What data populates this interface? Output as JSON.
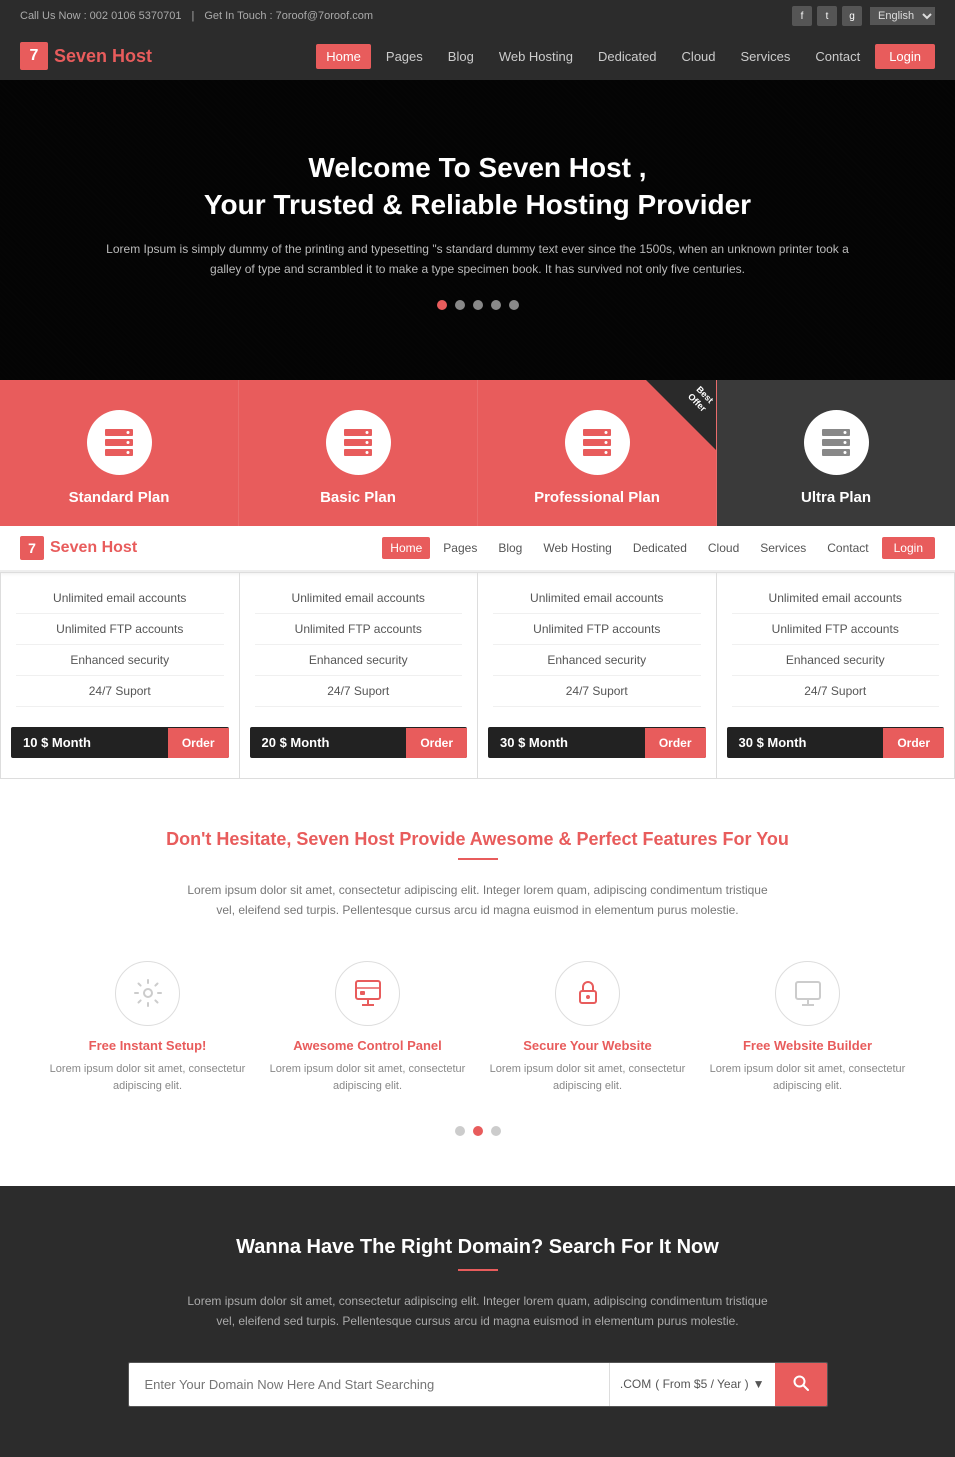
{
  "brand": {
    "number": "7",
    "name": "Seven Host"
  },
  "topbar": {
    "phone_label": "Call Us Now : 002 0106 5370701",
    "separator": "|",
    "email_label": "Get In Touch : 7oroof@7oroof.com",
    "social": [
      "f",
      "t",
      "g"
    ],
    "lang": "English"
  },
  "nav": {
    "links": [
      "Home",
      "Pages",
      "Blog",
      "Web Hosting",
      "Dedicated",
      "Cloud",
      "Services",
      "Contact"
    ],
    "active": "Home",
    "login": "Login"
  },
  "hero": {
    "title_line1": "Welcome To Seven Host ,",
    "title_line2": "Your Trusted & Reliable Hosting Provider",
    "description": "Lorem Ipsum is simply dummy of the printing and typesetting \"s standard dummy text ever since the 1500s, when an unknown printer took a galley of type and scrambled it to make a type specimen book. It has survived not only five centuries.",
    "dots": 5
  },
  "plans_hero": [
    {
      "name": "Standard Plan",
      "dark": false,
      "best_offer": false
    },
    {
      "name": "Basic Plan",
      "dark": false,
      "best_offer": false
    },
    {
      "name": "Professional Plan",
      "dark": false,
      "best_offer": true
    },
    {
      "name": "Ultra Plan",
      "dark": true,
      "best_offer": false
    }
  ],
  "plans_detail": [
    {
      "features": [
        "Unlimited email accounts",
        "Unlimited FTP accounts",
        "Enhanced security",
        "24/7 Suport"
      ],
      "price": "10 $ Month",
      "order": "Order"
    },
    {
      "features": [
        "Unlimited email accounts",
        "Unlimited FTP accounts",
        "Enhanced security",
        "24/7 Suport"
      ],
      "price": "20 $ Month",
      "order": "Order"
    },
    {
      "features": [
        "Unlimited email accounts",
        "Unlimited FTP accounts",
        "Enhanced security",
        "24/7 Suport"
      ],
      "price": "30 $ Month",
      "order": "Order"
    },
    {
      "features": [
        "Unlimited email accounts",
        "Unlimited FTP accounts",
        "Enhanced security",
        "24/7 Suport"
      ],
      "price": "30 $ Month",
      "order": "Order"
    }
  ],
  "features_section": {
    "title": "Don't Hesitate, Seven Host Provide Awesome & Perfect Features For You",
    "description": "Lorem ipsum dolor sit amet, consectetur adipiscing elit. Integer lorem quam, adipiscing condimentum tristique vel, eleifend sed turpis. Pellentesque cursus arcu id magna euismod in elementum purus molestie.",
    "items": [
      {
        "title": "Free Instant Setup!",
        "desc": "Lorem ipsum dolor sit amet, consectetur adipiscing elit.",
        "icon": "gear"
      },
      {
        "title": "Awesome Control Panel",
        "desc": "Lorem ipsum dolor sit amet, consectetur adipiscing elit.",
        "icon": "panel"
      },
      {
        "title": "Secure Your Website",
        "desc": "Lorem ipsum dolor sit amet, consectetur adipiscing elit.",
        "icon": "lock"
      },
      {
        "title": "Free Website Builder",
        "desc": "Lorem ipsum dolor sit amet, consectetur adipiscing elit.",
        "icon": "monitor"
      }
    ]
  },
  "domain_section": {
    "title": "Wanna Have The Right Domain? Search For It Now",
    "description": "Lorem ipsum dolor sit amet, consectetur adipiscing elit. Integer lorem quam, adipiscing condimentum tristique vel, eleifend sed turpis. Pellentesque cursus arcu id magna euismod in elementum purus molestie.",
    "input_placeholder": "Enter Your Domain Now Here And Start Searching",
    "ext_label": ".COM",
    "ext_price": "( From $5 / Year )",
    "search_btn": "🔍"
  },
  "colors": {
    "primary": "#e85c5c",
    "dark": "#2c2c2c",
    "mid_dark": "#3a3a3a"
  }
}
